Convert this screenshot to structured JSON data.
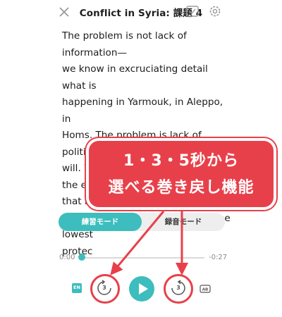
{
  "header": {
    "title": "Conflict in Syria: 課題 4",
    "close_icon": "close-icon",
    "check_icon": "checkbox-icon",
    "settings_icon": "gear-icon"
  },
  "passage": {
    "text": "The problem is not lack of information—we know in excruciating detail what is happening in Yarmouk, in Aleppo, in Homs. The problem is lack of political will. We cannot look at Syria, and the evil that has arisen from the ashes of indecision, and think this is not the lowest ... protect ..."
  },
  "passage_lines": [
    "The problem is not lack of information—",
    "we know in excruciating detail what is",
    "happening in Yarmouk, in Aleppo, in",
    "Homs. The problem is lack of political",
    "will. We cannot look at Syria, and the evil",
    "that has arisen from the ashes of",
    "indecision, and think this is not the",
    "lowest",
    "protec"
  ],
  "modes": {
    "practice": "練習モード",
    "record": "録音モード",
    "active": "practice"
  },
  "player": {
    "time_start": "0:00",
    "time_end": "-0:27",
    "progress": 0.0,
    "language_badge": "EN",
    "rewind_seconds": "3",
    "forward_seconds": "3",
    "ab_label": "AB"
  },
  "callout": {
    "line1": "1・3・5秒から",
    "line2": "選べる巻き戻し機能"
  },
  "colors": {
    "accent": "#3dbdbd",
    "highlight": "#e8404a"
  }
}
